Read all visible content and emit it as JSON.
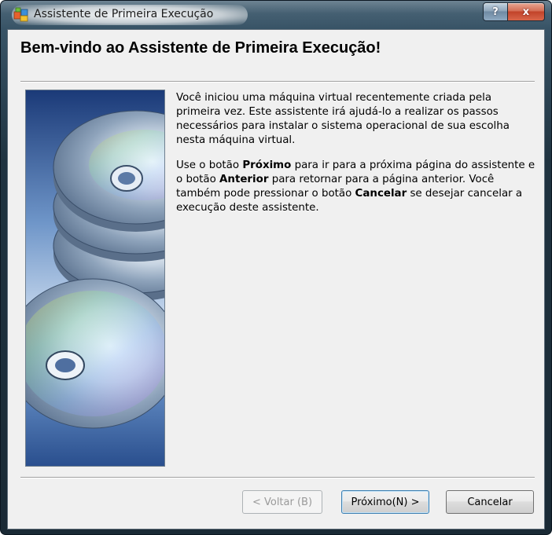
{
  "window": {
    "title": "Assistente de Primeira Execução",
    "help_label": "?",
    "close_label": "x"
  },
  "page": {
    "heading": "Bem-vindo ao Assistente de Primeira Execução!"
  },
  "content": {
    "p1": "Você iniciou uma máquina virtual recentemente criada pela primeira vez. Este assistente irá ajudá-lo a realizar os passos necessários para instalar o sistema operacional de sua escolha nesta máquina virtual.",
    "p2_a": "Use o botão ",
    "p2_b": "Próximo",
    "p2_c": " para ir para a próxima página do assistente e o botão ",
    "p2_d": "Anterior",
    "p2_e": " para retornar para a página anterior. Você também pode pressionar o botão ",
    "p2_f": "Cancelar",
    "p2_g": " se desejar cancelar a execução deste assistente."
  },
  "buttons": {
    "back": "< Voltar (B)",
    "next": "Próximo(N) >",
    "cancel": "Cancelar"
  }
}
